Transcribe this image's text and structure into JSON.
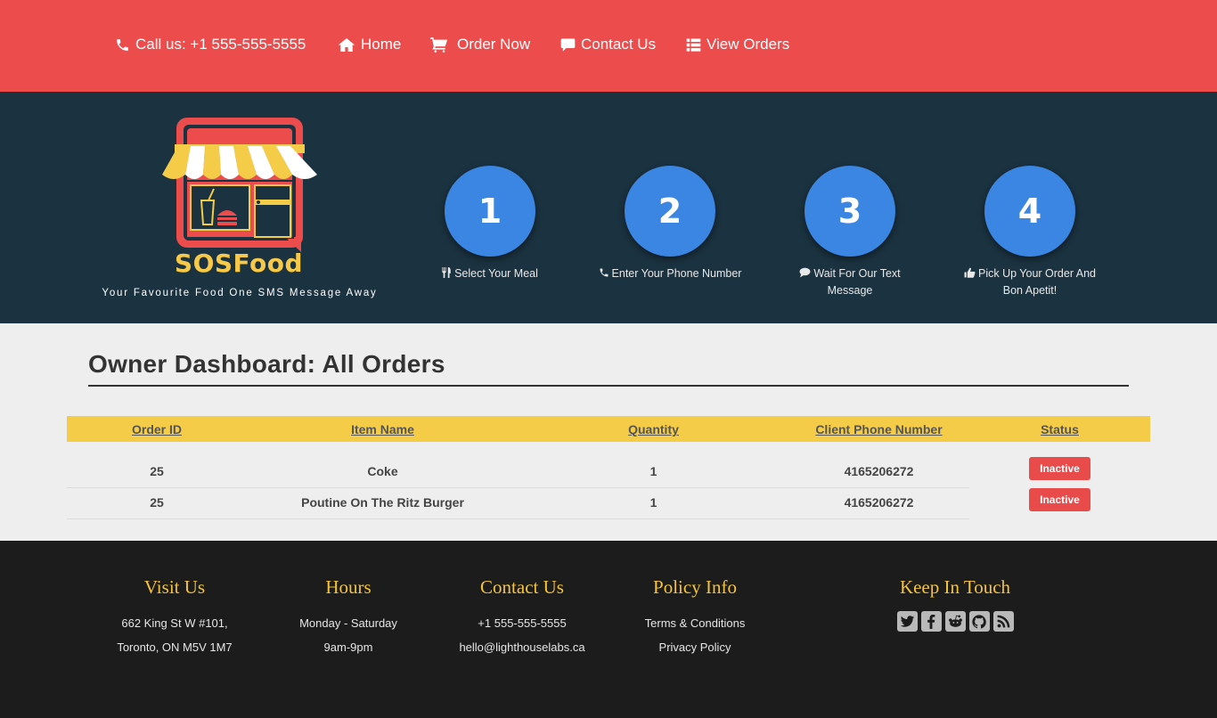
{
  "nav": {
    "items": [
      {
        "icon": "phone-icon",
        "label": "Call us: +1 555-555-5555"
      },
      {
        "icon": "home-icon",
        "label": "Home"
      },
      {
        "icon": "cart-icon",
        "label": "Order Now"
      },
      {
        "icon": "comment-icon",
        "label": "Contact Us"
      },
      {
        "icon": "list-icon",
        "label": "View Orders"
      }
    ]
  },
  "hero": {
    "brand": "SOSFood",
    "tagline": "Your Favourite Food One SMS Message Away",
    "steps": [
      {
        "number": "1",
        "icon": "cutlery-icon",
        "label": "Select Your Meal"
      },
      {
        "number": "2",
        "icon": "phone-icon",
        "label": "Enter Your Phone Number"
      },
      {
        "number": "3",
        "icon": "chat-icon",
        "label": "Wait For Our Text Message"
      },
      {
        "number": "4",
        "icon": "thumbs-up-icon",
        "label": "Pick Up Your Order And Bon Apetit!"
      }
    ]
  },
  "dashboard": {
    "title": "Owner Dashboard: All Orders",
    "columns": [
      "Order ID",
      "Item Name",
      "Quantity",
      "Client Phone Number",
      "Status"
    ],
    "rows": [
      {
        "order_id": "25",
        "item": "Coke",
        "quantity": "1",
        "phone": "4165206272",
        "status": "Inactive"
      },
      {
        "order_id": "25",
        "item": "Poutine On The Ritz Burger",
        "quantity": "1",
        "phone": "4165206272",
        "status": "Inactive"
      }
    ]
  },
  "footer": {
    "visit": {
      "heading": "Visit Us",
      "line1": "662 King St W #101,",
      "line2": "Toronto, ON M5V 1M7"
    },
    "hours": {
      "heading": "Hours",
      "line1": "Monday - Saturday",
      "line2": "9am-9pm"
    },
    "contact": {
      "heading": "Contact Us",
      "phone": "+1 555-555-5555",
      "email": "hello@lighthouselabs.ca"
    },
    "policy": {
      "heading": "Policy Info",
      "terms": "Terms & Conditions",
      "privacy": "Privacy Policy"
    },
    "social": {
      "heading": "Keep In Touch",
      "icons": [
        "twitter-icon",
        "facebook-icon",
        "reddit-icon",
        "github-icon",
        "rss-icon"
      ]
    }
  },
  "colors": {
    "nav_bg": "#ec4c4c",
    "hero_bg": "#1b3240",
    "step_circle": "#3b86e3",
    "table_header": "#f5cc47",
    "badge_inactive": "#e94b4b",
    "footer_bg": "#1c1c1c",
    "footer_heading": "#f5c33b"
  }
}
